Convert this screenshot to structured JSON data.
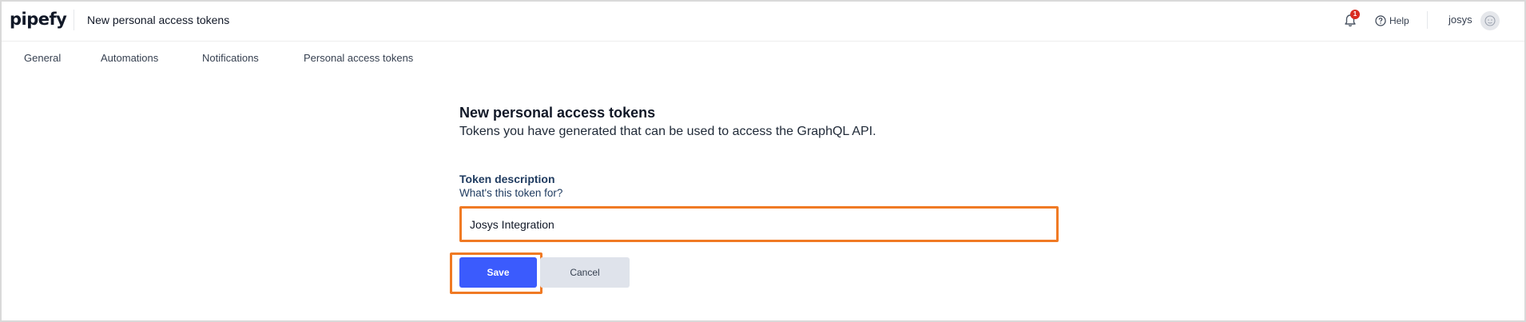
{
  "header": {
    "logo": "pipefy",
    "title": "New personal access tokens",
    "notification_count": "1",
    "help_label": "Help",
    "user_name": "josys",
    "icons": {
      "notification": "bell-icon",
      "help": "question-circle-icon",
      "avatar": "user-avatar-icon"
    }
  },
  "nav": {
    "tabs": [
      {
        "label": "General"
      },
      {
        "label": "Automations"
      },
      {
        "label": "Notifications"
      },
      {
        "label": "Personal access tokens"
      }
    ]
  },
  "main": {
    "title": "New personal access tokens",
    "subtitle": "Tokens you have generated that can be used to access the GraphQL API.",
    "field": {
      "label": "Token description",
      "help": "What's this token for?",
      "value": "Josys Integration"
    },
    "actions": {
      "save_label": "Save",
      "cancel_label": "Cancel"
    }
  },
  "colors": {
    "primary": "#3b5bfd",
    "highlight": "#f07a24",
    "badge": "#d92d20",
    "secondary_button": "#dfe3eb"
  }
}
